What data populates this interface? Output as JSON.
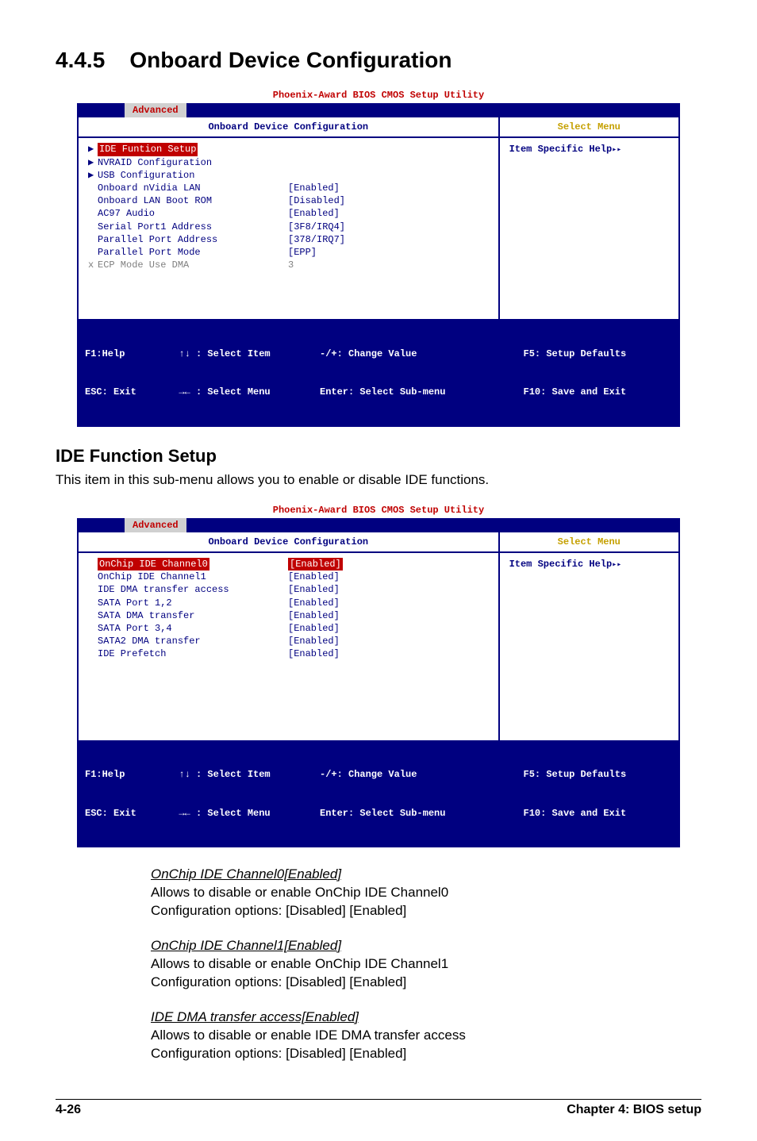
{
  "section": {
    "number": "4.4.5",
    "title": "Onboard Device Configuration"
  },
  "bios1": {
    "caption": "Phoenix-Award BIOS CMOS Setup Utility",
    "tab": "Advanced",
    "panel_title": "Onboard Device Configuration",
    "select_menu": "Select Menu",
    "help_label": "Item Specific Help",
    "rows": [
      {
        "mk": "▶",
        "label": "IDE Funtion Setup",
        "value": "",
        "highlight": true
      },
      {
        "mk": "▶",
        "label": "NVRAID Configuration",
        "value": ""
      },
      {
        "mk": "▶",
        "label": "USB Configuration",
        "value": ""
      },
      {
        "mk": " ",
        "label": "Onboard nVidia LAN",
        "value": "[Enabled]"
      },
      {
        "mk": " ",
        "label": "Onboard LAN Boot ROM",
        "value": "[Disabled]"
      },
      {
        "mk": " ",
        "label": "AC97 Audio",
        "value": "[Enabled]"
      },
      {
        "mk": " ",
        "label": "Serial Port1 Address",
        "value": "[3F8/IRQ4]"
      },
      {
        "mk": " ",
        "label": "Parallel Port Address",
        "value": "[378/IRQ7]"
      },
      {
        "mk": " ",
        "label": "Parallel Port Mode",
        "value": "[EPP]"
      },
      {
        "mk": "x",
        "label": "ECP Mode Use DMA",
        "value": "3",
        "disabled": true
      }
    ],
    "footer": {
      "f1": "F1:Help",
      "esc": "ESC: Exit",
      "sel_item": "↑↓ : Select Item",
      "sel_menu": "→← : Select Menu",
      "chg": "-/+: Change Value",
      "enter": "Enter: Select Sub-menu",
      "f5": "F5: Setup Defaults",
      "f10": "F10: Save and Exit"
    }
  },
  "ide_section": {
    "title": "IDE Function Setup",
    "desc": "This item in this sub-menu allows you to enable or disable IDE functions."
  },
  "bios2": {
    "caption": "Phoenix-Award BIOS CMOS Setup Utility",
    "tab": "Advanced",
    "panel_title": "Onboard Device Configuration",
    "select_menu": "Select Menu",
    "help_label": "Item Specific Help",
    "rows": [
      {
        "mk": " ",
        "label": "OnChip IDE Channel0",
        "value": "[Enabled]",
        "highlight": true
      },
      {
        "mk": " ",
        "label": "OnChip IDE Channel1",
        "value": "[Enabled]"
      },
      {
        "mk": " ",
        "label": "IDE DMA transfer access",
        "value": "[Enabled]"
      },
      {
        "mk": " ",
        "label": "SATA Port 1,2",
        "value": "[Enabled]"
      },
      {
        "mk": " ",
        "label": "SATA DMA transfer",
        "value": "[Enabled]"
      },
      {
        "mk": " ",
        "label": "SATA Port 3,4",
        "value": "[Enabled]"
      },
      {
        "mk": " ",
        "label": "SATA2 DMA transfer",
        "value": "[Enabled]"
      },
      {
        "mk": " ",
        "label": "IDE Prefetch",
        "value": "[Enabled]"
      }
    ],
    "footer": {
      "f1": "F1:Help",
      "esc": "ESC: Exit",
      "sel_item": "↑↓ : Select Item",
      "sel_menu": "→← : Select Menu",
      "chg": "-/+: Change Value",
      "enter": "Enter: Select Sub-menu",
      "f5": "F5: Setup Defaults",
      "f10": "F10: Save and Exit"
    }
  },
  "subitems": [
    {
      "title": "OnChip IDE Channel0[Enabled]",
      "line1": "Allows to disable or enable OnChip IDE Channel0",
      "line2": "Configuration options: [Disabled] [Enabled]"
    },
    {
      "title": "OnChip IDE Channel1[Enabled]",
      "line1": "Allows to disable or enable OnChip IDE Channel1",
      "line2": "Configuration options: [Disabled] [Enabled]"
    },
    {
      "title": "IDE DMA transfer access[Enabled]",
      "line1": "Allows to disable or enable IDE DMA transfer access",
      "line2": "Configuration options: [Disabled] [Enabled]"
    }
  ],
  "pagefoot": {
    "left": "4-26",
    "right": "Chapter 4: BIOS setup"
  }
}
